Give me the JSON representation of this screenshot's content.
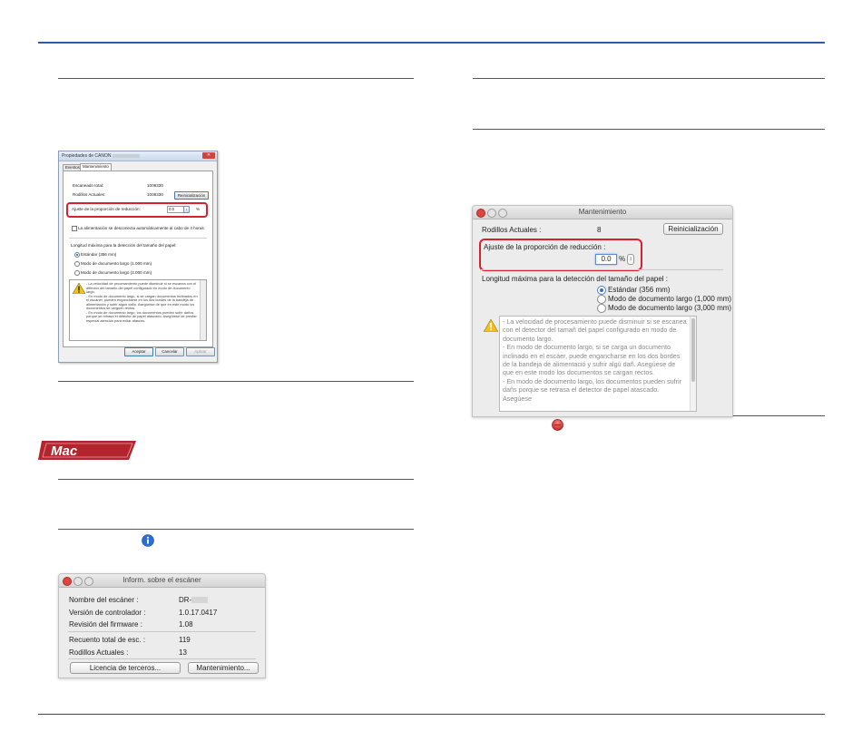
{
  "windows_dialog": {
    "title": "Propiedades de CANON",
    "close": "✕",
    "tabs": [
      "Eventos",
      "Mantenimiento"
    ],
    "total_scans_label": "Escaneado total:",
    "total_scans_value": "1008330",
    "rollers_label": "Rodillos Actuales:",
    "rollers_value": "1008330",
    "reset_button": "Reinicialización",
    "reduction_label": "Ajuste de la proporción de reducción:",
    "reduction_value": "0.0",
    "reduction_unit": "%",
    "power_off_label": "La alimentación se desconecta automáticamente al cabo de 4 horas",
    "length_label": "Longitud máxima para la detección del tamaño del papel:",
    "radio_options": [
      "Estándar (356 mm)",
      "Modo de documento largo (1.000 mm)",
      "Modo de documento largo (3.000 mm)"
    ],
    "note": "- La velocidad de procesamiento puede disminuir si se escanea con el detector del tamaño del papel configurado en modo de documento largo.\n- En modo de documento largo, si se cargan documentos inclinados en el escáner, pueden engancharse en los dos bordes de la bandeja de alimentación y sufrir algún daño. Asegúrese de que en este modo los documentos se carguen rectos.\n- En modo de documento largo, los documentos pueden sufrir daños porque se retrasa el detector de papel atascado. Asegúrese de prestar especial atención para evitar atascos.",
    "buttons": [
      "Aceptar",
      "Cancelar",
      "Aplicar"
    ]
  },
  "mac_badge": {
    "label": "Mac",
    "color": "#b3242c"
  },
  "info_icon": "info-icon",
  "mac_info": {
    "title": "Inform. sobre el escáner",
    "rows": [
      {
        "label": "Nombre del escáner :",
        "value": "DR-"
      },
      {
        "label": "Versión de controlador :",
        "value": "1.0.17.0417"
      },
      {
        "label": "Revisión del firmware :",
        "value": "1.08"
      },
      {
        "label": "Recuento total de esc. :",
        "value": "119"
      },
      {
        "label": "Rodillos Actuales :",
        "value": "13"
      }
    ],
    "license_button": "Licencia de terceros...",
    "maintenance_button": "Mantenimiento..."
  },
  "mac_maintenance": {
    "title": "Mantenimiento",
    "rollers_label": "Rodillos Actuales :",
    "rollers_value": "8",
    "reset_button": "Reinicialización",
    "reduction_label": "Ajuste de la proporción de reducción :",
    "reduction_value": "0.0",
    "reduction_unit": "%",
    "length_label": "Longitud máxima para la detección del tamaño del papel :",
    "radio_options": [
      "Estándar (356 mm)",
      "Modo de documento largo (1,000 mm)",
      "Modo de documento largo (3,000 mm)"
    ],
    "note": "- La velocidad de procesamiento puede disminuir si se escanea con el detector del tamañ del papel configurado en modo de documento largo.\n- En modo de documento largo, si se carga un documento inclinado en el escáer, puede engancharse en los dos bordes de la bandeja de alimentació y sufrir algú dañ. Asegúese de que en este modo los documentos se cargan rectos.\n- En modo de documento largo, los documentos pueden sufrir dañs porque se retrasa el detector de papel atascado. Asegúese"
  },
  "close_icon": "red-close-button-icon",
  "colors": {
    "header_rule": "#2e5aa8",
    "highlight": "#d6212e"
  }
}
